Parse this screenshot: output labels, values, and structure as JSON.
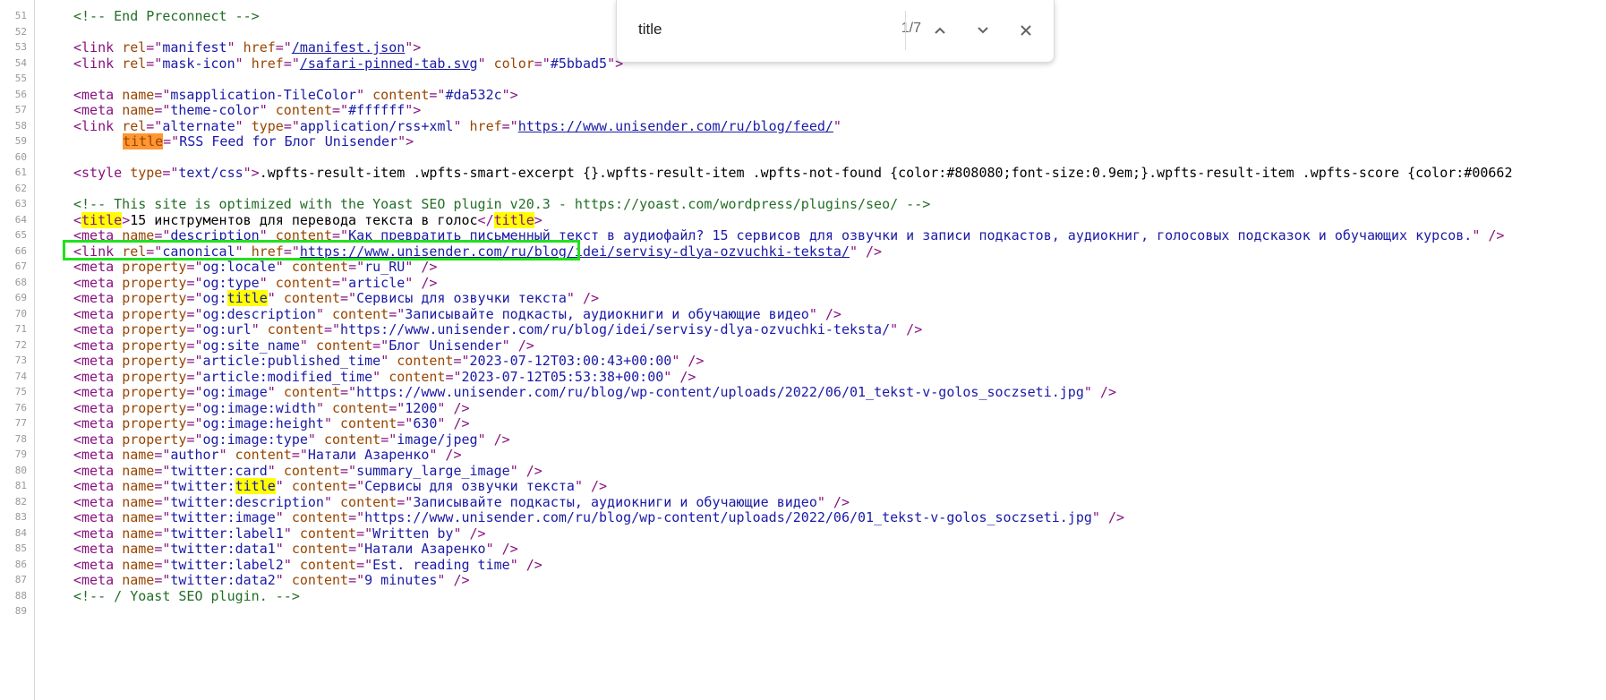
{
  "find_bar": {
    "query": "title",
    "match_count": "1/7",
    "prev_icon": "chevron-up-icon",
    "next_icon": "chevron-down-icon",
    "close_icon": "close-icon"
  },
  "lines": [
    {
      "num": "51",
      "parts": [
        [
          "c",
          "<!-- End Preconnect -->"
        ]
      ]
    },
    {
      "num": "52",
      "parts": []
    },
    {
      "num": "53",
      "parts": [
        [
          "t",
          "<link "
        ],
        [
          "a",
          "rel"
        ],
        [
          "t",
          "=\""
        ],
        [
          "v",
          "manifest"
        ],
        [
          "t",
          "\" "
        ],
        [
          "a",
          "href"
        ],
        [
          "t",
          "=\""
        ],
        [
          "l",
          "/manifest.json"
        ],
        [
          "t",
          "\">"
        ]
      ]
    },
    {
      "num": "54",
      "parts": [
        [
          "t",
          "<link "
        ],
        [
          "a",
          "rel"
        ],
        [
          "t",
          "=\""
        ],
        [
          "v",
          "mask-icon"
        ],
        [
          "t",
          "\" "
        ],
        [
          "a",
          "href"
        ],
        [
          "t",
          "=\""
        ],
        [
          "l",
          "/safari-pinned-tab.svg"
        ],
        [
          "t",
          "\" "
        ],
        [
          "a",
          "color"
        ],
        [
          "t",
          "=\""
        ],
        [
          "v",
          "#5bbad5"
        ],
        [
          "t",
          "\">"
        ]
      ]
    },
    {
      "num": "55",
      "parts": []
    },
    {
      "num": "56",
      "parts": [
        [
          "t",
          "<meta "
        ],
        [
          "a",
          "name"
        ],
        [
          "t",
          "=\""
        ],
        [
          "v",
          "msapplication-TileColor"
        ],
        [
          "t",
          "\" "
        ],
        [
          "a",
          "content"
        ],
        [
          "t",
          "=\""
        ],
        [
          "v",
          "#da532c"
        ],
        [
          "t",
          "\">"
        ]
      ]
    },
    {
      "num": "57",
      "parts": [
        [
          "t",
          "<meta "
        ],
        [
          "a",
          "name"
        ],
        [
          "t",
          "=\""
        ],
        [
          "v",
          "theme-color"
        ],
        [
          "t",
          "\" "
        ],
        [
          "a",
          "content"
        ],
        [
          "t",
          "=\""
        ],
        [
          "v",
          "#ffffff"
        ],
        [
          "t",
          "\">"
        ]
      ]
    },
    {
      "num": "58",
      "parts": [
        [
          "t",
          "<link "
        ],
        [
          "a",
          "rel"
        ],
        [
          "t",
          "=\""
        ],
        [
          "v",
          "alternate"
        ],
        [
          "t",
          "\" "
        ],
        [
          "a",
          "type"
        ],
        [
          "t",
          "=\""
        ],
        [
          "v",
          "application/rss+xml"
        ],
        [
          "t",
          "\" "
        ],
        [
          "a",
          "href"
        ],
        [
          "t",
          "=\""
        ],
        [
          "l",
          "https://www.unisender.com/ru/blog/feed/"
        ],
        [
          "t",
          "\""
        ]
      ]
    },
    {
      "num": "59",
      "indent": true,
      "parts": [
        [
          "a hl-cur",
          "title"
        ],
        [
          "t",
          "=\""
        ],
        [
          "v",
          "RSS Feed for Блог Unisender"
        ],
        [
          "t",
          "\">"
        ]
      ]
    },
    {
      "num": "60",
      "parts": []
    },
    {
      "num": "61",
      "parts": [
        [
          "t",
          "<style "
        ],
        [
          "a",
          "type"
        ],
        [
          "t",
          "=\""
        ],
        [
          "v",
          "text/css"
        ],
        [
          "t",
          "\">"
        ],
        [
          "x",
          ".wpfts-result-item .wpfts-smart-excerpt {}.wpfts-result-item .wpfts-not-found {color:#808080;font-size:0.9em;}.wpfts-result-item .wpfts-score {color:#00662"
        ]
      ]
    },
    {
      "num": "62",
      "parts": []
    },
    {
      "num": "63",
      "parts": [
        [
          "c",
          "<!-- This site is optimized with the Yoast SEO plugin v20.3 - https://yoast.com/wordpress/plugins/seo/ -->"
        ]
      ]
    },
    {
      "num": "64",
      "parts": [
        [
          "t",
          "<"
        ],
        [
          "t hl",
          "title"
        ],
        [
          "t",
          ">"
        ],
        [
          "x",
          "15 инструментов для перевода текста в голос"
        ],
        [
          "t",
          "</"
        ],
        [
          "t hl",
          "title"
        ],
        [
          "t",
          ">"
        ]
      ]
    },
    {
      "num": "65",
      "parts": [
        [
          "t",
          "<meta "
        ],
        [
          "a",
          "name"
        ],
        [
          "t",
          "=\""
        ],
        [
          "v",
          "description"
        ],
        [
          "t",
          "\" "
        ],
        [
          "a",
          "content"
        ],
        [
          "t",
          "=\""
        ],
        [
          "v",
          "Как превратить письменный текст в аудиофайл? 15 сервисов для озвучки и записи подкастов, аудиокниг, голосовых подсказок и обучающих курсов."
        ],
        [
          "t",
          "\" />"
        ]
      ]
    },
    {
      "num": "66",
      "parts": [
        [
          "t",
          "<link "
        ],
        [
          "a",
          "rel"
        ],
        [
          "t",
          "=\""
        ],
        [
          "v",
          "canonical"
        ],
        [
          "t",
          "\" "
        ],
        [
          "a",
          "href"
        ],
        [
          "t",
          "=\""
        ],
        [
          "l",
          "https://www.unisender.com/ru/blog/idei/servisy-dlya-ozvuchki-teksta/"
        ],
        [
          "t",
          "\" />"
        ]
      ]
    },
    {
      "num": "67",
      "parts": [
        [
          "t",
          "<meta "
        ],
        [
          "a",
          "property"
        ],
        [
          "t",
          "=\""
        ],
        [
          "v",
          "og:locale"
        ],
        [
          "t",
          "\" "
        ],
        [
          "a",
          "content"
        ],
        [
          "t",
          "=\""
        ],
        [
          "v",
          "ru_RU"
        ],
        [
          "t",
          "\" />"
        ]
      ]
    },
    {
      "num": "68",
      "parts": [
        [
          "t",
          "<meta "
        ],
        [
          "a",
          "property"
        ],
        [
          "t",
          "=\""
        ],
        [
          "v",
          "og:type"
        ],
        [
          "t",
          "\" "
        ],
        [
          "a",
          "content"
        ],
        [
          "t",
          "=\""
        ],
        [
          "v",
          "article"
        ],
        [
          "t",
          "\" />"
        ]
      ]
    },
    {
      "num": "69",
      "parts": [
        [
          "t",
          "<meta "
        ],
        [
          "a",
          "property"
        ],
        [
          "t",
          "=\""
        ],
        [
          "v",
          "og:"
        ],
        [
          "v hl",
          "title"
        ],
        [
          "t",
          "\" "
        ],
        [
          "a",
          "content"
        ],
        [
          "t",
          "=\""
        ],
        [
          "v",
          "Сервисы для озвучки текста"
        ],
        [
          "t",
          "\" />"
        ]
      ]
    },
    {
      "num": "70",
      "parts": [
        [
          "t",
          "<meta "
        ],
        [
          "a",
          "property"
        ],
        [
          "t",
          "=\""
        ],
        [
          "v",
          "og:description"
        ],
        [
          "t",
          "\" "
        ],
        [
          "a",
          "content"
        ],
        [
          "t",
          "=\""
        ],
        [
          "v",
          "Записывайте подкасты, аудиокниги и обучающие видео"
        ],
        [
          "t",
          "\" />"
        ]
      ]
    },
    {
      "num": "71",
      "parts": [
        [
          "t",
          "<meta "
        ],
        [
          "a",
          "property"
        ],
        [
          "t",
          "=\""
        ],
        [
          "v",
          "og:url"
        ],
        [
          "t",
          "\" "
        ],
        [
          "a",
          "content"
        ],
        [
          "t",
          "=\""
        ],
        [
          "v",
          "https://www.unisender.com/ru/blog/idei/servisy-dlya-ozvuchki-teksta/"
        ],
        [
          "t",
          "\" />"
        ]
      ]
    },
    {
      "num": "72",
      "parts": [
        [
          "t",
          "<meta "
        ],
        [
          "a",
          "property"
        ],
        [
          "t",
          "=\""
        ],
        [
          "v",
          "og:site_name"
        ],
        [
          "t",
          "\" "
        ],
        [
          "a",
          "content"
        ],
        [
          "t",
          "=\""
        ],
        [
          "v",
          "Блог Unisender"
        ],
        [
          "t",
          "\" />"
        ]
      ]
    },
    {
      "num": "73",
      "parts": [
        [
          "t",
          "<meta "
        ],
        [
          "a",
          "property"
        ],
        [
          "t",
          "=\""
        ],
        [
          "v",
          "article:published_time"
        ],
        [
          "t",
          "\" "
        ],
        [
          "a",
          "content"
        ],
        [
          "t",
          "=\""
        ],
        [
          "v",
          "2023-07-12T03:00:43+00:00"
        ],
        [
          "t",
          "\" />"
        ]
      ]
    },
    {
      "num": "74",
      "parts": [
        [
          "t",
          "<meta "
        ],
        [
          "a",
          "property"
        ],
        [
          "t",
          "=\""
        ],
        [
          "v",
          "article:modified_time"
        ],
        [
          "t",
          "\" "
        ],
        [
          "a",
          "content"
        ],
        [
          "t",
          "=\""
        ],
        [
          "v",
          "2023-07-12T05:53:38+00:00"
        ],
        [
          "t",
          "\" />"
        ]
      ]
    },
    {
      "num": "75",
      "parts": [
        [
          "t",
          "<meta "
        ],
        [
          "a",
          "property"
        ],
        [
          "t",
          "=\""
        ],
        [
          "v",
          "og:image"
        ],
        [
          "t",
          "\" "
        ],
        [
          "a",
          "content"
        ],
        [
          "t",
          "=\""
        ],
        [
          "v",
          "https://www.unisender.com/ru/blog/wp-content/uploads/2022/06/01_tekst-v-golos_soczseti.jpg"
        ],
        [
          "t",
          "\" />"
        ]
      ]
    },
    {
      "num": "76",
      "parts": [
        [
          "t",
          "<meta "
        ],
        [
          "a",
          "property"
        ],
        [
          "t",
          "=\""
        ],
        [
          "v",
          "og:image:width"
        ],
        [
          "t",
          "\" "
        ],
        [
          "a",
          "content"
        ],
        [
          "t",
          "=\""
        ],
        [
          "v",
          "1200"
        ],
        [
          "t",
          "\" />"
        ]
      ]
    },
    {
      "num": "77",
      "parts": [
        [
          "t",
          "<meta "
        ],
        [
          "a",
          "property"
        ],
        [
          "t",
          "=\""
        ],
        [
          "v",
          "og:image:height"
        ],
        [
          "t",
          "\" "
        ],
        [
          "a",
          "content"
        ],
        [
          "t",
          "=\""
        ],
        [
          "v",
          "630"
        ],
        [
          "t",
          "\" />"
        ]
      ]
    },
    {
      "num": "78",
      "parts": [
        [
          "t",
          "<meta "
        ],
        [
          "a",
          "property"
        ],
        [
          "t",
          "=\""
        ],
        [
          "v",
          "og:image:type"
        ],
        [
          "t",
          "\" "
        ],
        [
          "a",
          "content"
        ],
        [
          "t",
          "=\""
        ],
        [
          "v",
          "image/jpeg"
        ],
        [
          "t",
          "\" />"
        ]
      ]
    },
    {
      "num": "79",
      "parts": [
        [
          "t",
          "<meta "
        ],
        [
          "a",
          "name"
        ],
        [
          "t",
          "=\""
        ],
        [
          "v",
          "author"
        ],
        [
          "t",
          "\" "
        ],
        [
          "a",
          "content"
        ],
        [
          "t",
          "=\""
        ],
        [
          "v",
          "Натали Азаренко"
        ],
        [
          "t",
          "\" />"
        ]
      ]
    },
    {
      "num": "80",
      "parts": [
        [
          "t",
          "<meta "
        ],
        [
          "a",
          "name"
        ],
        [
          "t",
          "=\""
        ],
        [
          "v",
          "twitter:card"
        ],
        [
          "t",
          "\" "
        ],
        [
          "a",
          "content"
        ],
        [
          "t",
          "=\""
        ],
        [
          "v",
          "summary_large_image"
        ],
        [
          "t",
          "\" />"
        ]
      ]
    },
    {
      "num": "81",
      "parts": [
        [
          "t",
          "<meta "
        ],
        [
          "a",
          "name"
        ],
        [
          "t",
          "=\""
        ],
        [
          "v",
          "twitter:"
        ],
        [
          "v hl",
          "title"
        ],
        [
          "t",
          "\" "
        ],
        [
          "a",
          "content"
        ],
        [
          "t",
          "=\""
        ],
        [
          "v",
          "Сервисы для озвучки текста"
        ],
        [
          "t",
          "\" />"
        ]
      ]
    },
    {
      "num": "82",
      "parts": [
        [
          "t",
          "<meta "
        ],
        [
          "a",
          "name"
        ],
        [
          "t",
          "=\""
        ],
        [
          "v",
          "twitter:description"
        ],
        [
          "t",
          "\" "
        ],
        [
          "a",
          "content"
        ],
        [
          "t",
          "=\""
        ],
        [
          "v",
          "Записывайте подкасты, аудиокниги и обучающие видео"
        ],
        [
          "t",
          "\" />"
        ]
      ]
    },
    {
      "num": "83",
      "parts": [
        [
          "t",
          "<meta "
        ],
        [
          "a",
          "name"
        ],
        [
          "t",
          "=\""
        ],
        [
          "v",
          "twitter:image"
        ],
        [
          "t",
          "\" "
        ],
        [
          "a",
          "content"
        ],
        [
          "t",
          "=\""
        ],
        [
          "v",
          "https://www.unisender.com/ru/blog/wp-content/uploads/2022/06/01_tekst-v-golos_soczseti.jpg"
        ],
        [
          "t",
          "\" />"
        ]
      ]
    },
    {
      "num": "84",
      "parts": [
        [
          "t",
          "<meta "
        ],
        [
          "a",
          "name"
        ],
        [
          "t",
          "=\""
        ],
        [
          "v",
          "twitter:label1"
        ],
        [
          "t",
          "\" "
        ],
        [
          "a",
          "content"
        ],
        [
          "t",
          "=\""
        ],
        [
          "v",
          "Written by"
        ],
        [
          "t",
          "\" />"
        ]
      ]
    },
    {
      "num": "85",
      "parts": [
        [
          "t",
          "<meta "
        ],
        [
          "a",
          "name"
        ],
        [
          "t",
          "=\""
        ],
        [
          "v",
          "twitter:data1"
        ],
        [
          "t",
          "\" "
        ],
        [
          "a",
          "content"
        ],
        [
          "t",
          "=\""
        ],
        [
          "v",
          "Натали Азаренко"
        ],
        [
          "t",
          "\" />"
        ]
      ]
    },
    {
      "num": "86",
      "parts": [
        [
          "t",
          "<meta "
        ],
        [
          "a",
          "name"
        ],
        [
          "t",
          "=\""
        ],
        [
          "v",
          "twitter:label2"
        ],
        [
          "t",
          "\" "
        ],
        [
          "a",
          "content"
        ],
        [
          "t",
          "=\""
        ],
        [
          "v",
          "Est. reading time"
        ],
        [
          "t",
          "\" />"
        ]
      ]
    },
    {
      "num": "87",
      "parts": [
        [
          "t",
          "<meta "
        ],
        [
          "a",
          "name"
        ],
        [
          "t",
          "=\""
        ],
        [
          "v",
          "twitter:data2"
        ],
        [
          "t",
          "\" "
        ],
        [
          "a",
          "content"
        ],
        [
          "t",
          "=\""
        ],
        [
          "v",
          "9 minutes"
        ],
        [
          "t",
          "\" />"
        ]
      ]
    },
    {
      "num": "88",
      "parts": [
        [
          "c",
          "<!-- / Yoast SEO plugin. -->"
        ]
      ]
    },
    {
      "num": "89",
      "parts": []
    }
  ]
}
